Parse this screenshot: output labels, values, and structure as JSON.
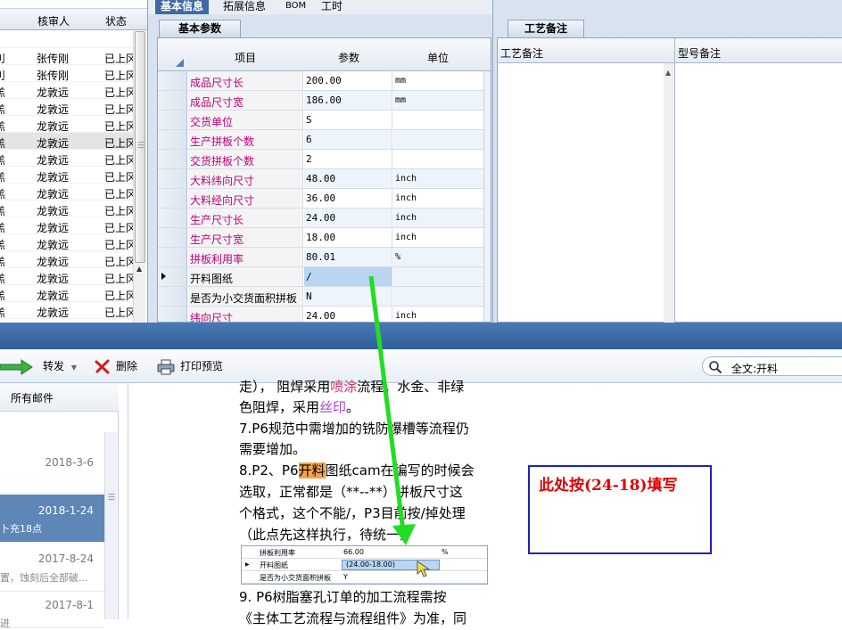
{
  "left_list": {
    "headers": [
      "核审人",
      "状态"
    ],
    "rows": [
      {
        "prefix": "",
        "reviewer": "",
        "status": ""
      },
      {
        "prefix": "刂",
        "reviewer": "张传刚",
        "status": "已上冈"
      },
      {
        "prefix": "刂",
        "reviewer": "张传刚",
        "status": "已上冈"
      },
      {
        "prefix": "羔",
        "reviewer": "龙敦远",
        "status": "已上冈"
      },
      {
        "prefix": "羔",
        "reviewer": "龙敦远",
        "status": "已上冈"
      },
      {
        "prefix": "羔",
        "reviewer": "龙敦远",
        "status": "已上冈"
      },
      {
        "prefix": "羔",
        "reviewer": "龙敦远",
        "status": "已上冈"
      },
      {
        "prefix": "羔",
        "reviewer": "龙敦远",
        "status": "已上冈"
      },
      {
        "prefix": "羔",
        "reviewer": "龙敦远",
        "status": "已上冈"
      },
      {
        "prefix": "羔",
        "reviewer": "龙敦远",
        "status": "已上冈"
      },
      {
        "prefix": "羔",
        "reviewer": "龙敦远",
        "status": "已上冈"
      },
      {
        "prefix": "羔",
        "reviewer": "龙敦远",
        "status": "已上冈"
      },
      {
        "prefix": "羔",
        "reviewer": "龙敦远",
        "status": "已上冈"
      },
      {
        "prefix": "羔",
        "reviewer": "龙敦远",
        "status": "已上冈"
      },
      {
        "prefix": "羔",
        "reviewer": "龙敦远",
        "status": "已上冈"
      },
      {
        "prefix": "羔",
        "reviewer": "龙敦远",
        "status": "已上冈"
      },
      {
        "prefix": "羔",
        "reviewer": "龙敦远",
        "status": "已上冈"
      }
    ]
  },
  "top_tabs": [
    "基本信息",
    "拓展信息",
    "BOM",
    "工时"
  ],
  "basic_params": {
    "tab": "基本参数",
    "headers": [
      "项目",
      "参数",
      "单位"
    ],
    "rows": [
      {
        "item": "成品尺寸长",
        "value": "200.00",
        "unit": "mm"
      },
      {
        "item": "成品尺寸宽",
        "value": "186.00",
        "unit": "mm"
      },
      {
        "item": "交货单位",
        "value": "S",
        "unit": ""
      },
      {
        "item": "生产拼板个数",
        "value": "6",
        "unit": ""
      },
      {
        "item": "交货拼板个数",
        "value": "2",
        "unit": ""
      },
      {
        "item": "大料纬向尺寸",
        "value": "48.00",
        "unit": "inch"
      },
      {
        "item": "大料经向尺寸",
        "value": "36.00",
        "unit": "inch"
      },
      {
        "item": "生产尺寸长",
        "value": "24.00",
        "unit": "inch"
      },
      {
        "item": "生产尺寸宽",
        "value": "18.00",
        "unit": "inch"
      },
      {
        "item": "拼板利用率",
        "value": "80.01",
        "unit": "%"
      },
      {
        "item": "开料图纸",
        "value": "/",
        "unit": ""
      },
      {
        "item": "是否为小交货面积拼板",
        "value": "N",
        "unit": ""
      },
      {
        "item": "纬向尺寸",
        "value": "24.00",
        "unit": "inch"
      }
    ]
  },
  "process_notes": {
    "tab": "工艺备注",
    "col1": "工艺备注",
    "col2": "型号备注"
  },
  "toolbar": {
    "forward": "转发",
    "delete": "删除",
    "print_preview": "打印预览",
    "search": "全文:开料"
  },
  "mail_list": {
    "header": "所有邮件",
    "items": [
      {
        "date": "2018-3-6",
        "snippet": ""
      },
      {
        "date": "2018-1-24",
        "snippet": "卜充18点"
      },
      {
        "date": "2017-8-24",
        "snippet": "置，蚀刻后全部破..."
      },
      {
        "date": "2017-8-1",
        "snippet": "进"
      }
    ]
  },
  "reader": {
    "line0a": "走）， 阻焊采用",
    "line0b": "喷涂",
    "line0c": "流程，水金、非绿",
    "line1a": "色阻焊，采用",
    "line1b": "丝印",
    "line1c": "。",
    "line2": "7.P6规范中需增加的铣防爆槽等流程仍",
    "line3": "需要增加。",
    "line4a": "8.P2、P6",
    "line4b": "开料",
    "line4c": "图纸cam在编写的时候会",
    "line5": "选取，正常都是（**--**）拼板尺寸这",
    "line6": "个格式，这个不能/，P3目前按/掉处理",
    "line7": "（此点先这样执行，待统一）",
    "line8": "9.  P6树脂塞孔订单的加工流程需按",
    "line9": "《主体工艺流程与流程组件》为准，同"
  },
  "embedded_grid": {
    "rows": [
      {
        "item": "拼板利用率",
        "value": "66.00",
        "unit": "%"
      },
      {
        "item": "开料图纸",
        "value": "(24.00-18.00)",
        "unit": ""
      },
      {
        "item": "是否为小交货面积拼板",
        "value": "Y",
        "unit": ""
      }
    ]
  },
  "note": "此处按(24-18)填写",
  "colors": {
    "accent": "#3d6aa5",
    "pink_label": "#c0007a",
    "highlight": "#f4a34a",
    "arrow": "#22dd22",
    "note_border": "#2020c0",
    "note_text": "#e00000"
  }
}
